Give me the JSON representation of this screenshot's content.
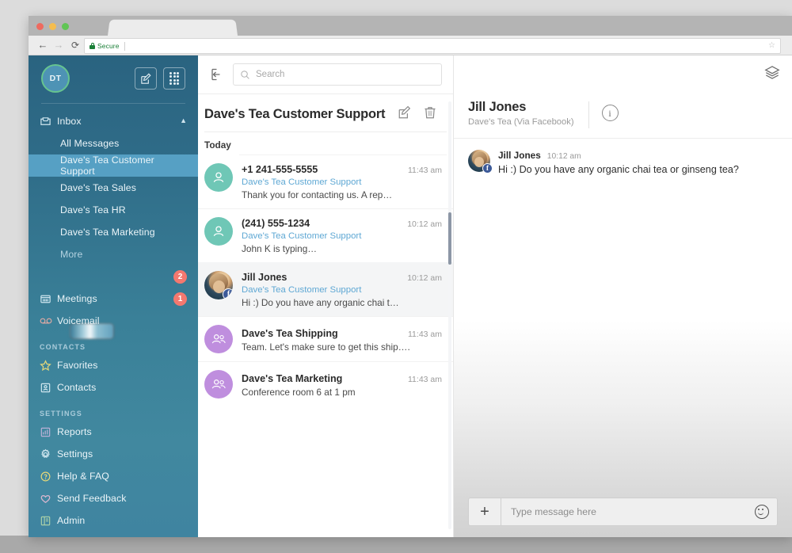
{
  "browser": {
    "secure_label": "Secure",
    "url": "",
    "back_icon": "back-arrow-icon",
    "forward_icon": "forward-arrow-icon",
    "reload_icon": "reload-icon",
    "bookmark_icon": "star-icon"
  },
  "sidebar": {
    "avatar_initials": "DT",
    "compose_icon": "compose-pencil-icon",
    "dialpad_icon": "dialpad-icon",
    "inbox": {
      "label": "Inbox",
      "icon": "inbox-tray-icon",
      "chevron": "ⱏ"
    },
    "inbox_children": [
      {
        "label": "All Messages",
        "active": false
      },
      {
        "label": "Dave's Tea Customer Support",
        "active": true
      },
      {
        "label": "Dave's Tea Sales",
        "active": false
      },
      {
        "label": "Dave's Tea HR",
        "active": false
      },
      {
        "label": "Dave's Tea Marketing",
        "active": false
      },
      {
        "label": "More",
        "active": false,
        "muted": true
      }
    ],
    "redacted_item": {
      "label": "",
      "badge": "2",
      "icon": "obscured-item"
    },
    "meetings": {
      "label": "Meetings",
      "badge": "1",
      "icon": "meetings-calendar-icon"
    },
    "voicemail": {
      "label": "Voicemail",
      "icon": "voicemail-icon"
    },
    "contacts_header": "CONTACTS",
    "contacts_items": [
      {
        "label": "Favorites",
        "icon": "star-icon"
      },
      {
        "label": "Contacts",
        "icon": "contact-card-icon"
      }
    ],
    "settings_header": "SETTINGS",
    "settings_items": [
      {
        "label": "Reports",
        "icon": "bar-chart-icon"
      },
      {
        "label": "Settings",
        "icon": "gear-icon"
      },
      {
        "label": "Help & FAQ",
        "icon": "question-circle-icon"
      },
      {
        "label": "Send Feedback",
        "icon": "heart-icon"
      },
      {
        "label": "Admin",
        "icon": "admin-book-icon"
      }
    ]
  },
  "topbar": {
    "collapse_icon": "collapse-panel-icon",
    "search_placeholder": "Search",
    "search_value": "",
    "search_icon": "search-icon",
    "layers_icon": "layers-stack-icon"
  },
  "list": {
    "title": "Dave's Tea Customer Support",
    "edit_icon": "compose-pencil-icon",
    "delete_icon": "trash-icon",
    "day_label": "Today",
    "conversations": [
      {
        "name": "+1 241-555-5555",
        "channel": "Dave's Tea Customer Support",
        "preview": "Thank you for contacting us. A rep…",
        "time": "11:43 am",
        "avatar": "person-icon",
        "avatar_color": "#6fc7b6",
        "selected": false,
        "badge": ""
      },
      {
        "name": "(241) 555-1234",
        "channel": "Dave's Tea Customer Support",
        "preview": "John K is typing…",
        "time": "10:12 am",
        "avatar": "person-icon",
        "avatar_color": "#6fc7b6",
        "selected": false,
        "badge": ""
      },
      {
        "name": "Jill Jones",
        "channel": "Dave's Tea Customer Support",
        "preview": "Hi :) Do you have any organic chai t…",
        "time": "10:12 am",
        "avatar": "photo-avatar",
        "avatar_color": "",
        "selected": true,
        "badge": "facebook-badge"
      },
      {
        "name": "Dave's Tea Shipping",
        "channel": "",
        "preview": "Team.  Let's make sure to get this ship….",
        "time": "11:43 am",
        "avatar": "group-icon",
        "avatar_color": "#bf8ede",
        "selected": false,
        "badge": ""
      },
      {
        "name": "Dave's Tea Marketing",
        "channel": "",
        "preview": "Conference room 6 at 1 pm",
        "time": "11:43 am",
        "avatar": "group-icon",
        "avatar_color": "#bf8ede",
        "selected": false,
        "badge": ""
      }
    ]
  },
  "conversation": {
    "name": "Jill Jones",
    "subtitle": "Dave's Tea (Via Facebook)",
    "info_icon": "info-circle-icon",
    "info_glyph": "i",
    "messages": [
      {
        "author": "Jill Jones",
        "time": "10:12 am",
        "text": "Hi :) Do you have any organic chai tea or ginseng tea?",
        "avatar": "photo-avatar",
        "badge": "facebook-badge"
      }
    ],
    "composer": {
      "placeholder": "Type message here",
      "value": "",
      "add_icon": "plus-icon",
      "emoji_icon": "smiley-icon"
    }
  },
  "colors": {
    "sidebar_top": "#2a6380",
    "sidebar_bottom": "#3f84a0",
    "active_row": "#56a0c4",
    "badge_red": "#f4786f",
    "channel_link": "#5fa8d4",
    "avatar_teal": "#6fc7b6",
    "avatar_purple": "#bf8ede",
    "avatar_ring_green": "#66c48f",
    "facebook_blue": "#3b5998"
  }
}
